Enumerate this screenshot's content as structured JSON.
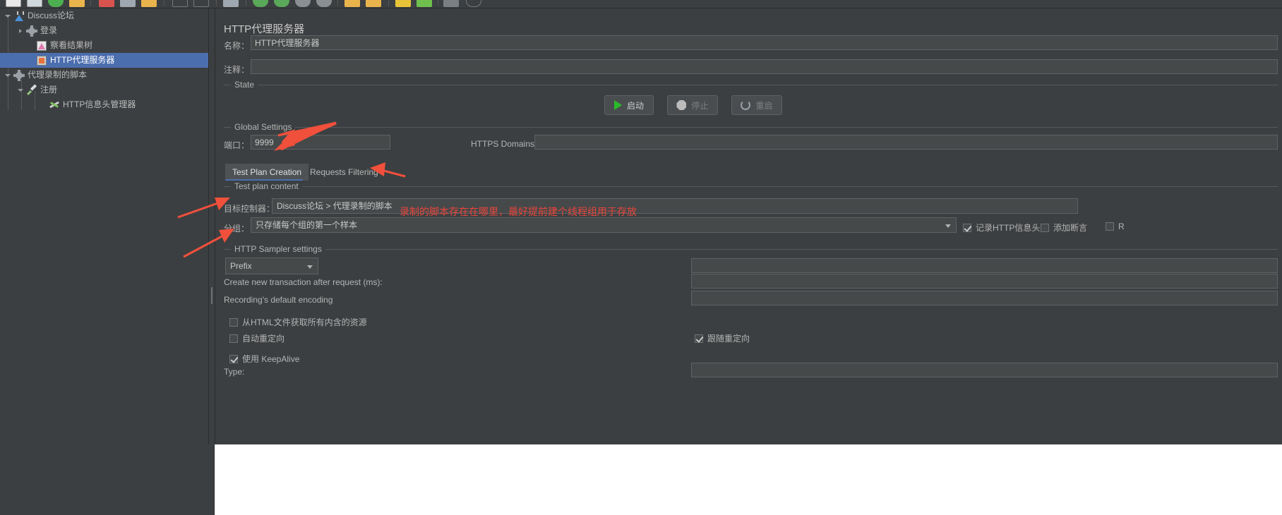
{
  "toolbar": {
    "icons": [
      "new-icon",
      "template-icon",
      "open-icon",
      "save-icon",
      "cut-icon",
      "copy-icon",
      "paste-icon",
      "expand-icon",
      "collapse-icon",
      "toggle-icon",
      "start-icon",
      "start-no-pause-icon",
      "stop-icon",
      "shutdown-icon",
      "clear-icon",
      "clear-all-icon",
      "search-icon",
      "reset-search-icon",
      "function-helper-icon",
      "help-icon"
    ]
  },
  "tree": {
    "items": [
      {
        "label": "Discuss论坛",
        "icon": "test-plan-icon",
        "depth": 0,
        "twisty": "open",
        "selected": false
      },
      {
        "label": "登录",
        "icon": "thread-group-icon",
        "depth": 1,
        "twisty": "closed",
        "selected": false
      },
      {
        "label": "察看结果树",
        "icon": "view-results-tree-icon",
        "depth": 1,
        "twisty": "none",
        "selected": false
      },
      {
        "label": "HTTP代理服务器",
        "icon": "http-proxy-server-icon",
        "depth": 1,
        "twisty": "none",
        "selected": true
      },
      {
        "label": "代理录制的脚本",
        "icon": "thread-group-icon",
        "depth": 0,
        "twisty": "open",
        "selected": false
      },
      {
        "label": "注册",
        "icon": "recording-controller-icon",
        "depth": 1,
        "twisty": "open",
        "selected": false
      },
      {
        "label": "HTTP信息头管理器",
        "icon": "header-manager-icon",
        "depth": 2,
        "twisty": "none",
        "selected": false
      }
    ]
  },
  "panel": {
    "title": "HTTP代理服务器",
    "name_label": "名称：",
    "name_value": "HTTP代理服务器",
    "comment_label": "注释：",
    "comment_value": "",
    "state_group": "State",
    "buttons": {
      "start": "启动",
      "stop": "停止",
      "restart": "重启"
    },
    "global_settings_group": "Global Settings",
    "port_label": "端口：",
    "port_value": "9999",
    "https_domains_label": "HTTPS Domains:",
    "https_domains_value": "",
    "tabs": [
      {
        "label": "Test Plan Creation",
        "active": true
      },
      {
        "label": "Requests Filtering",
        "active": false
      }
    ],
    "test_plan_content_group": "Test plan content",
    "target_controller_label": "目标控制器：",
    "target_controller_value": "Discuss论坛 > 代理录制的脚本",
    "grouping_label": "分组：",
    "grouping_value": "只存储每个组的第一个样本",
    "checkboxes_row": [
      {
        "label": "记录HTTP信息头",
        "checked": true
      },
      {
        "label": "添加断言",
        "checked": false
      },
      {
        "label": "R",
        "checked": false
      }
    ],
    "http_sampler_group": "HTTP Sampler settings",
    "prefix_select_value": "Prefix",
    "prefix_value": "",
    "transaction_label": "Create new transaction after request (ms):",
    "transaction_value": "",
    "encoding_label": "Recording's default encoding",
    "encoding_value": "",
    "options": [
      {
        "label": "从HTML文件获取所有内含的资源",
        "checked": false
      },
      {
        "label": "自动重定向",
        "checked": false
      },
      {
        "label": "使用 KeepAlive",
        "checked": true
      }
    ],
    "follow_redirects": {
      "label": "跟随重定向",
      "checked": true
    },
    "type_label": "Type:",
    "type_value": ""
  },
  "annotations": [
    {
      "text": "录制的脚本存在在哪里，最好提前建个线程组用于存放"
    }
  ],
  "colors": {
    "background": "#3c3f41",
    "selection": "#4b6eaf",
    "accent_red": "#e8453c",
    "text": "#b4b4b4",
    "input_bg": "#45494a",
    "border": "#5e6264",
    "play_green": "#29b929"
  }
}
